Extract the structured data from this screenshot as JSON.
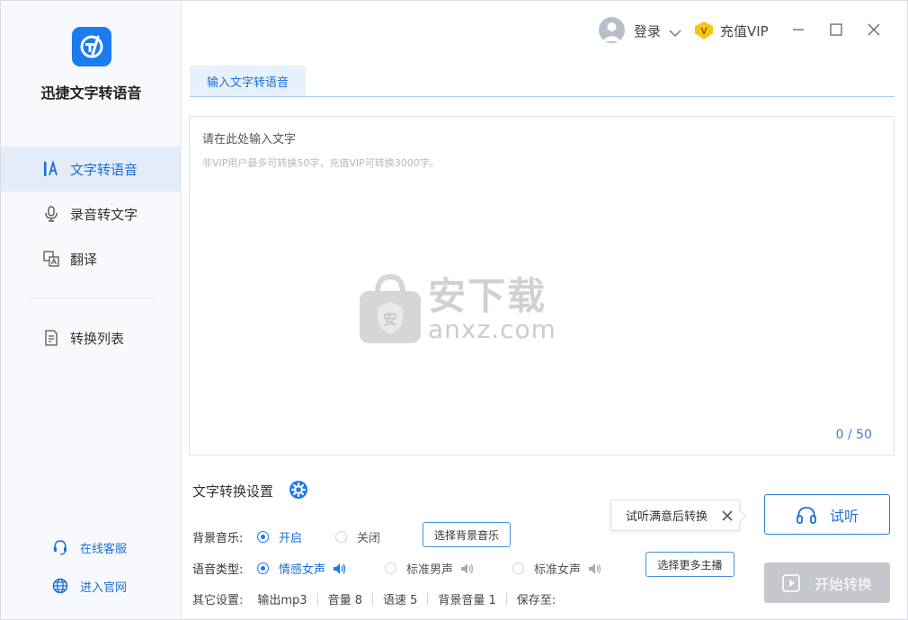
{
  "app": {
    "name": "迅捷文字转语音"
  },
  "sidebar": {
    "items": [
      {
        "label": "文字转语音",
        "icon": "text-to-speech-icon",
        "active": true
      },
      {
        "label": "录音转文字",
        "icon": "microphone-icon",
        "active": false
      },
      {
        "label": "翻译",
        "icon": "translate-icon",
        "active": false
      },
      {
        "label": "转换列表",
        "icon": "convert-list-icon",
        "active": false
      }
    ],
    "bottom_links": [
      {
        "label": "在线客服",
        "icon": "customer-service-icon"
      },
      {
        "label": "进入官网",
        "icon": "globe-icon"
      }
    ]
  },
  "titlebar": {
    "login_label": "登录",
    "vip_label": "充值VIP",
    "vip_badge_letter": "V"
  },
  "tabs": [
    {
      "label": "输入文字转语音",
      "active": true
    }
  ],
  "editor": {
    "placeholder": "请在此处输入文字",
    "hint": "非VIP用户最多可转换50字，充值VIP可转换3000字。",
    "counter": "0 / 50"
  },
  "watermark": {
    "cn": "安下载",
    "en": "anxz.com",
    "badge": "安"
  },
  "settings": {
    "title": "文字转换设置",
    "bgm": {
      "label": "背景音乐:",
      "options": [
        {
          "label": "开启",
          "selected": true
        },
        {
          "label": "关闭",
          "selected": false
        }
      ],
      "button": "选择背景音乐"
    },
    "voice": {
      "label": "语音类型:",
      "options": [
        {
          "label": "情感女声",
          "selected": true
        },
        {
          "label": "标准男声",
          "selected": false
        },
        {
          "label": "标准女声",
          "selected": false
        }
      ],
      "button": "选择更多主播"
    },
    "other": {
      "label": "其它设置:",
      "items": [
        "输出mp3",
        "音量 8",
        "语速 5",
        "背景音量 1",
        "保存至:"
      ]
    }
  },
  "actions": {
    "tooltip": "试听满意后转换",
    "listen": "试听",
    "convert": "开始转换"
  },
  "colors": {
    "accent": "#1a7cf0",
    "disabled": "#c4c7cc",
    "vip": "#f5c518"
  }
}
